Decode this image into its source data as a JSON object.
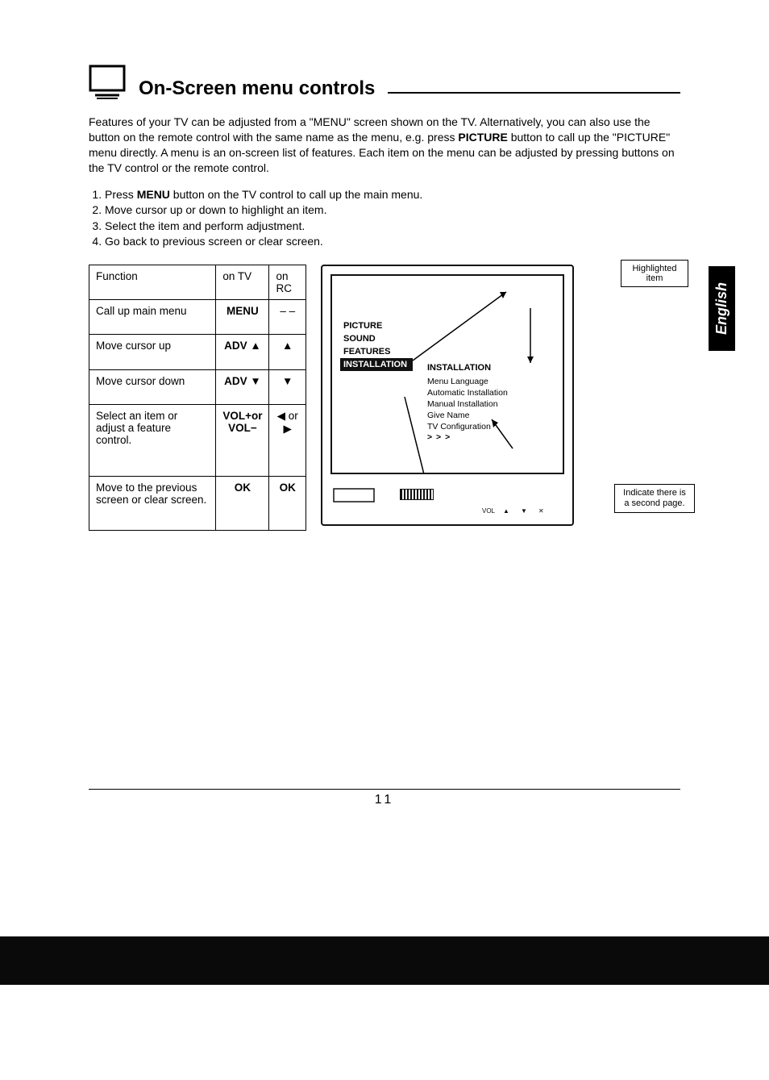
{
  "header": {
    "title": "On-Screen menu controls"
  },
  "intro_html": "Features of your TV can be adjusted from a \"MENU\" screen shown on the TV. Alternatively, you can also use the button on the remote control with the same name as the menu, e.g. press <b>PICTURE</b> button to call up the \"PICTURE\" menu directly. A menu is an on-screen list of features. Each item on the menu can be adjusted by pressing buttons on the TV control or the remote control.",
  "steps": [
    "Press <b>MENU</b> button on the TV control to call up the main menu.",
    "Move cursor up or down to highlight an item.",
    "Select the item and perform adjustment.",
    "Go back to previous screen or clear screen."
  ],
  "table": {
    "headers": [
      "Function",
      "on TV",
      "on RC"
    ],
    "rows": [
      {
        "fn": "Call up main menu",
        "tv": "MENU",
        "rc": "– –",
        "tv_bold": true
      },
      {
        "fn": "Move cursor up",
        "tv": "ADV ▲",
        "rc": "▲",
        "tv_bold": true
      },
      {
        "fn": "Move cursor down",
        "tv": "ADV ▼",
        "rc": "▼",
        "tv_bold": true
      },
      {
        "fn": "Select an item or adjust a feature control.",
        "tv": "VOL+or\nVOL−",
        "rc": "◀ or ▶",
        "tv_bold": true
      },
      {
        "fn": "Move to the previous screen or clear screen.",
        "tv": "OK",
        "rc": "OK",
        "tv_bold": true,
        "rc_bold": true
      }
    ]
  },
  "diagram": {
    "callout_highlighted": "Highlighted item",
    "callout_secondpage": "Indicate there is a second page.",
    "main_menu_items": [
      "PICTURE",
      "SOUND",
      "FEATURES",
      "INSTALLATION"
    ],
    "main_menu_selected_index": 3,
    "submenu_heading": "INSTALLATION",
    "submenu_items": [
      "Menu Language",
      "Automatic Installation",
      "Manual Installation",
      "Give Name",
      "TV Configuration"
    ],
    "submenu_more": "> > >"
  },
  "side_badge": "English",
  "page_number": "11"
}
